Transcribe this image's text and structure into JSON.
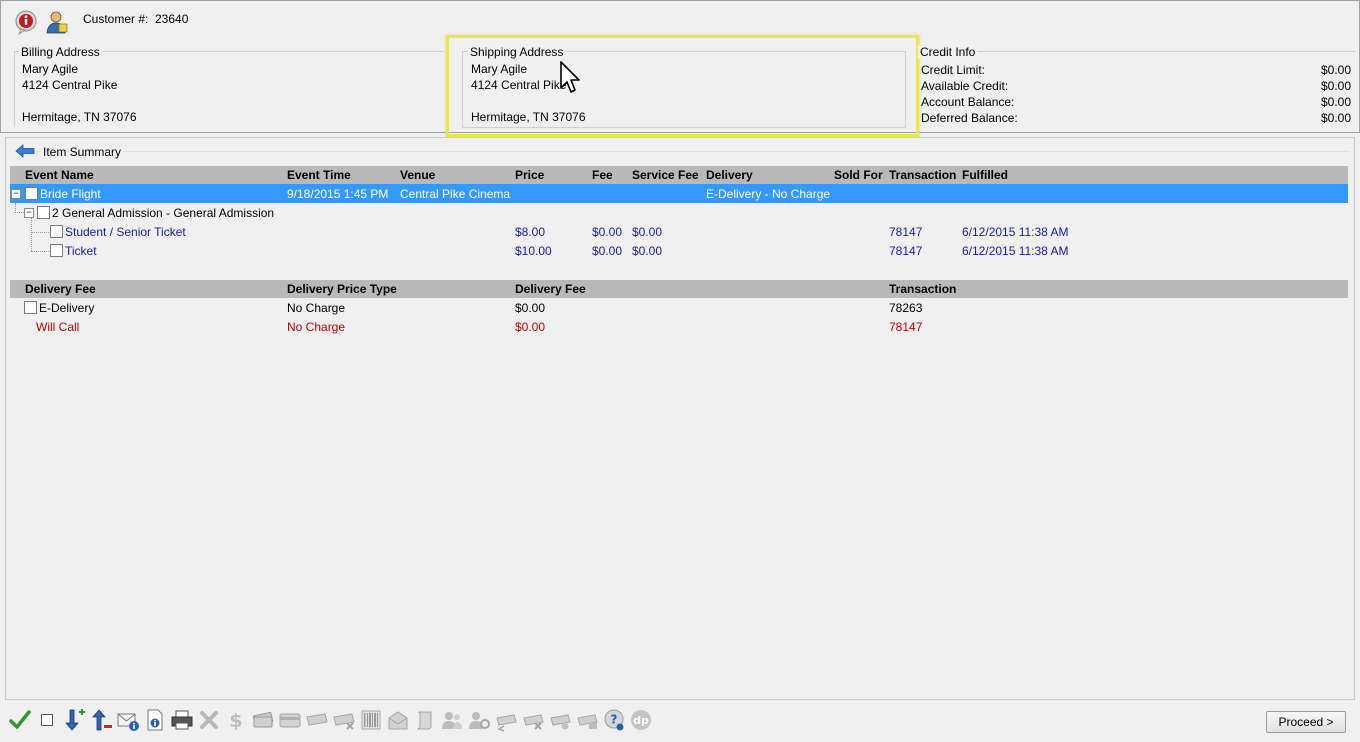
{
  "header": {
    "customer_label": "Customer #:",
    "customer_number": "23640"
  },
  "billing": {
    "title": "Billing Address",
    "name": "Mary Agile",
    "street": "4124 Central Pike",
    "city": "Hermitage, TN 37076"
  },
  "shipping": {
    "title": "Shipping Address",
    "name": "Mary Agile",
    "street": "4124 Central Pike",
    "city": "Hermitage, TN 37076"
  },
  "credit": {
    "title": "Credit Info",
    "rows": [
      {
        "label": "Credit Limit:",
        "value": "$0.00"
      },
      {
        "label": "Available Credit:",
        "value": "$0.00"
      },
      {
        "label": "Account Balance:",
        "value": "$0.00"
      },
      {
        "label": "Deferred Balance:",
        "value": "$0.00"
      }
    ]
  },
  "summary": {
    "title": "Item Summary"
  },
  "items_grid": {
    "columns": [
      "Event Name",
      "Event Time",
      "Venue",
      "Price",
      "Fee",
      "Service Fee",
      "Delivery",
      "Sold For",
      "Transaction",
      "Fulfilled"
    ],
    "event": {
      "name": "Bride Flight",
      "time": "9/18/2015 1:45 PM",
      "venue": "Central Pike Cinema",
      "delivery": "E-Delivery - No Charge"
    },
    "group": {
      "label": "2 General Admission - General Admission"
    },
    "tickets": [
      {
        "name": "Student / Senior Ticket",
        "price": "$8.00",
        "fee": "$0.00",
        "service_fee": "$0.00",
        "transaction": "78147",
        "fulfilled": "6/12/2015 11:38 AM"
      },
      {
        "name": "Ticket",
        "price": "$10.00",
        "fee": "$0.00",
        "service_fee": "$0.00",
        "transaction": "78147",
        "fulfilled": "6/12/2015 11:38 AM"
      }
    ]
  },
  "delivery_grid": {
    "columns": [
      "Delivery Fee",
      "Delivery Price Type",
      "Delivery Fee",
      "Transaction"
    ],
    "rows": [
      {
        "name": "E-Delivery",
        "price_type": "No Charge",
        "fee": "$0.00",
        "transaction": "78263",
        "voided": false
      },
      {
        "name": "Will Call",
        "price_type": "No Charge",
        "fee": "$0.00",
        "transaction": "78147",
        "voided": true
      }
    ]
  },
  "footer": {
    "proceed_label": "Proceed >"
  },
  "colors": {
    "selection": "#3399ff",
    "link_blue": "#1a1aaa",
    "void_red": "#c00000",
    "highlight": "#e8e84a",
    "grid_header": "#b9b9b9"
  }
}
